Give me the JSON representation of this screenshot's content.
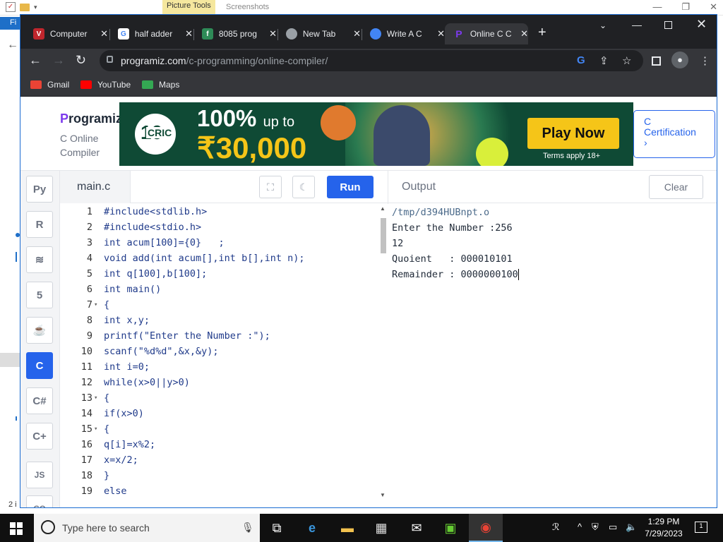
{
  "explorer": {
    "picture_tools": "Picture Tools",
    "screenshots_label": "Screenshots",
    "ribbon_tab": "Fi",
    "status_text": "2 i"
  },
  "browser": {
    "tabs": [
      {
        "title": "Computer",
        "favicon": "V",
        "color": "#c0262d"
      },
      {
        "title": "half adder",
        "favicon": "G",
        "color": "#4285f4"
      },
      {
        "title": "8085 prog",
        "favicon": "f",
        "color": "#2e8b57"
      },
      {
        "title": "New Tab",
        "favicon": "chrome-icon",
        "color": "#9aa0a6"
      },
      {
        "title": "Write A C",
        "favicon": "gemini-icon",
        "color": "#4285f4"
      },
      {
        "title": "Online C C",
        "favicon": "programiz-icon",
        "color": "#7c3aed"
      }
    ],
    "url_domain": "programiz.com",
    "url_path": "/c-programming/online-compiler/",
    "bookmarks": [
      {
        "label": "Gmail",
        "color": "#ea4335"
      },
      {
        "label": "YouTube",
        "color": "#ff0000"
      },
      {
        "label": "Maps",
        "color": "#34a853"
      }
    ]
  },
  "page": {
    "logo_first": "P",
    "logo_rest": "rogramiz",
    "subtitle_1": "C Online",
    "subtitle_2": "Compiler",
    "ad": {
      "brand_num": "10",
      "brand": "CRIC",
      "headline": "100%",
      "headline_small": "up to",
      "amount": "₹30,000",
      "cta": "Play Now",
      "terms": "Terms apply 18+"
    },
    "cert_lines": [
      "C",
      "Certification",
      "›"
    ]
  },
  "ide": {
    "languages": [
      "Python",
      "R",
      "SQL",
      "HTML",
      "Java",
      "C",
      "C#",
      "C++",
      "JS",
      "Go"
    ],
    "active_language": "C",
    "filename": "main.c",
    "run_label": "Run",
    "output_label": "Output",
    "clear_label": "Clear",
    "code": [
      {
        "n": "1",
        "fold": "",
        "t": "#include<stdlib.h>"
      },
      {
        "n": "2",
        "fold": "",
        "t": "#include<stdio.h>"
      },
      {
        "n": "3",
        "fold": "",
        "t": "int acum[100]={0}   ;"
      },
      {
        "n": "4",
        "fold": "",
        "t": "void add(int acum[],int b[],int n);"
      },
      {
        "n": "5",
        "fold": "",
        "t": "int q[100],b[100];"
      },
      {
        "n": "6",
        "fold": "",
        "t": "int main()"
      },
      {
        "n": "7",
        "fold": "▾",
        "t": "{"
      },
      {
        "n": "8",
        "fold": "",
        "t": "int x,y;"
      },
      {
        "n": "9",
        "fold": "",
        "t": "printf(\"Enter the Number :\");"
      },
      {
        "n": "10",
        "fold": "",
        "t": "scanf(\"%d%d\",&x,&y);"
      },
      {
        "n": "11",
        "fold": "",
        "t": "int i=0;"
      },
      {
        "n": "12",
        "fold": "",
        "t": "while(x>0||y>0)"
      },
      {
        "n": "13",
        "fold": "▾",
        "t": "{"
      },
      {
        "n": "14",
        "fold": "",
        "t": "if(x>0)"
      },
      {
        "n": "15",
        "fold": "▾",
        "t": "{"
      },
      {
        "n": "16",
        "fold": "",
        "t": "q[i]=x%2;"
      },
      {
        "n": "17",
        "fold": "",
        "t": "x=x/2;"
      },
      {
        "n": "18",
        "fold": "",
        "t": "}"
      },
      {
        "n": "19",
        "fold": "",
        "t": "else"
      }
    ],
    "output_lines": [
      "/tmp/d394HUBnpt.o",
      "Enter the Number :256",
      "12",
      "Quoient   : 000010101",
      "Remainder : 0000000100"
    ]
  },
  "taskbar": {
    "search_placeholder": "Type here to search",
    "time": "1:29 PM",
    "date": "7/29/2023",
    "notification_count": "1"
  }
}
